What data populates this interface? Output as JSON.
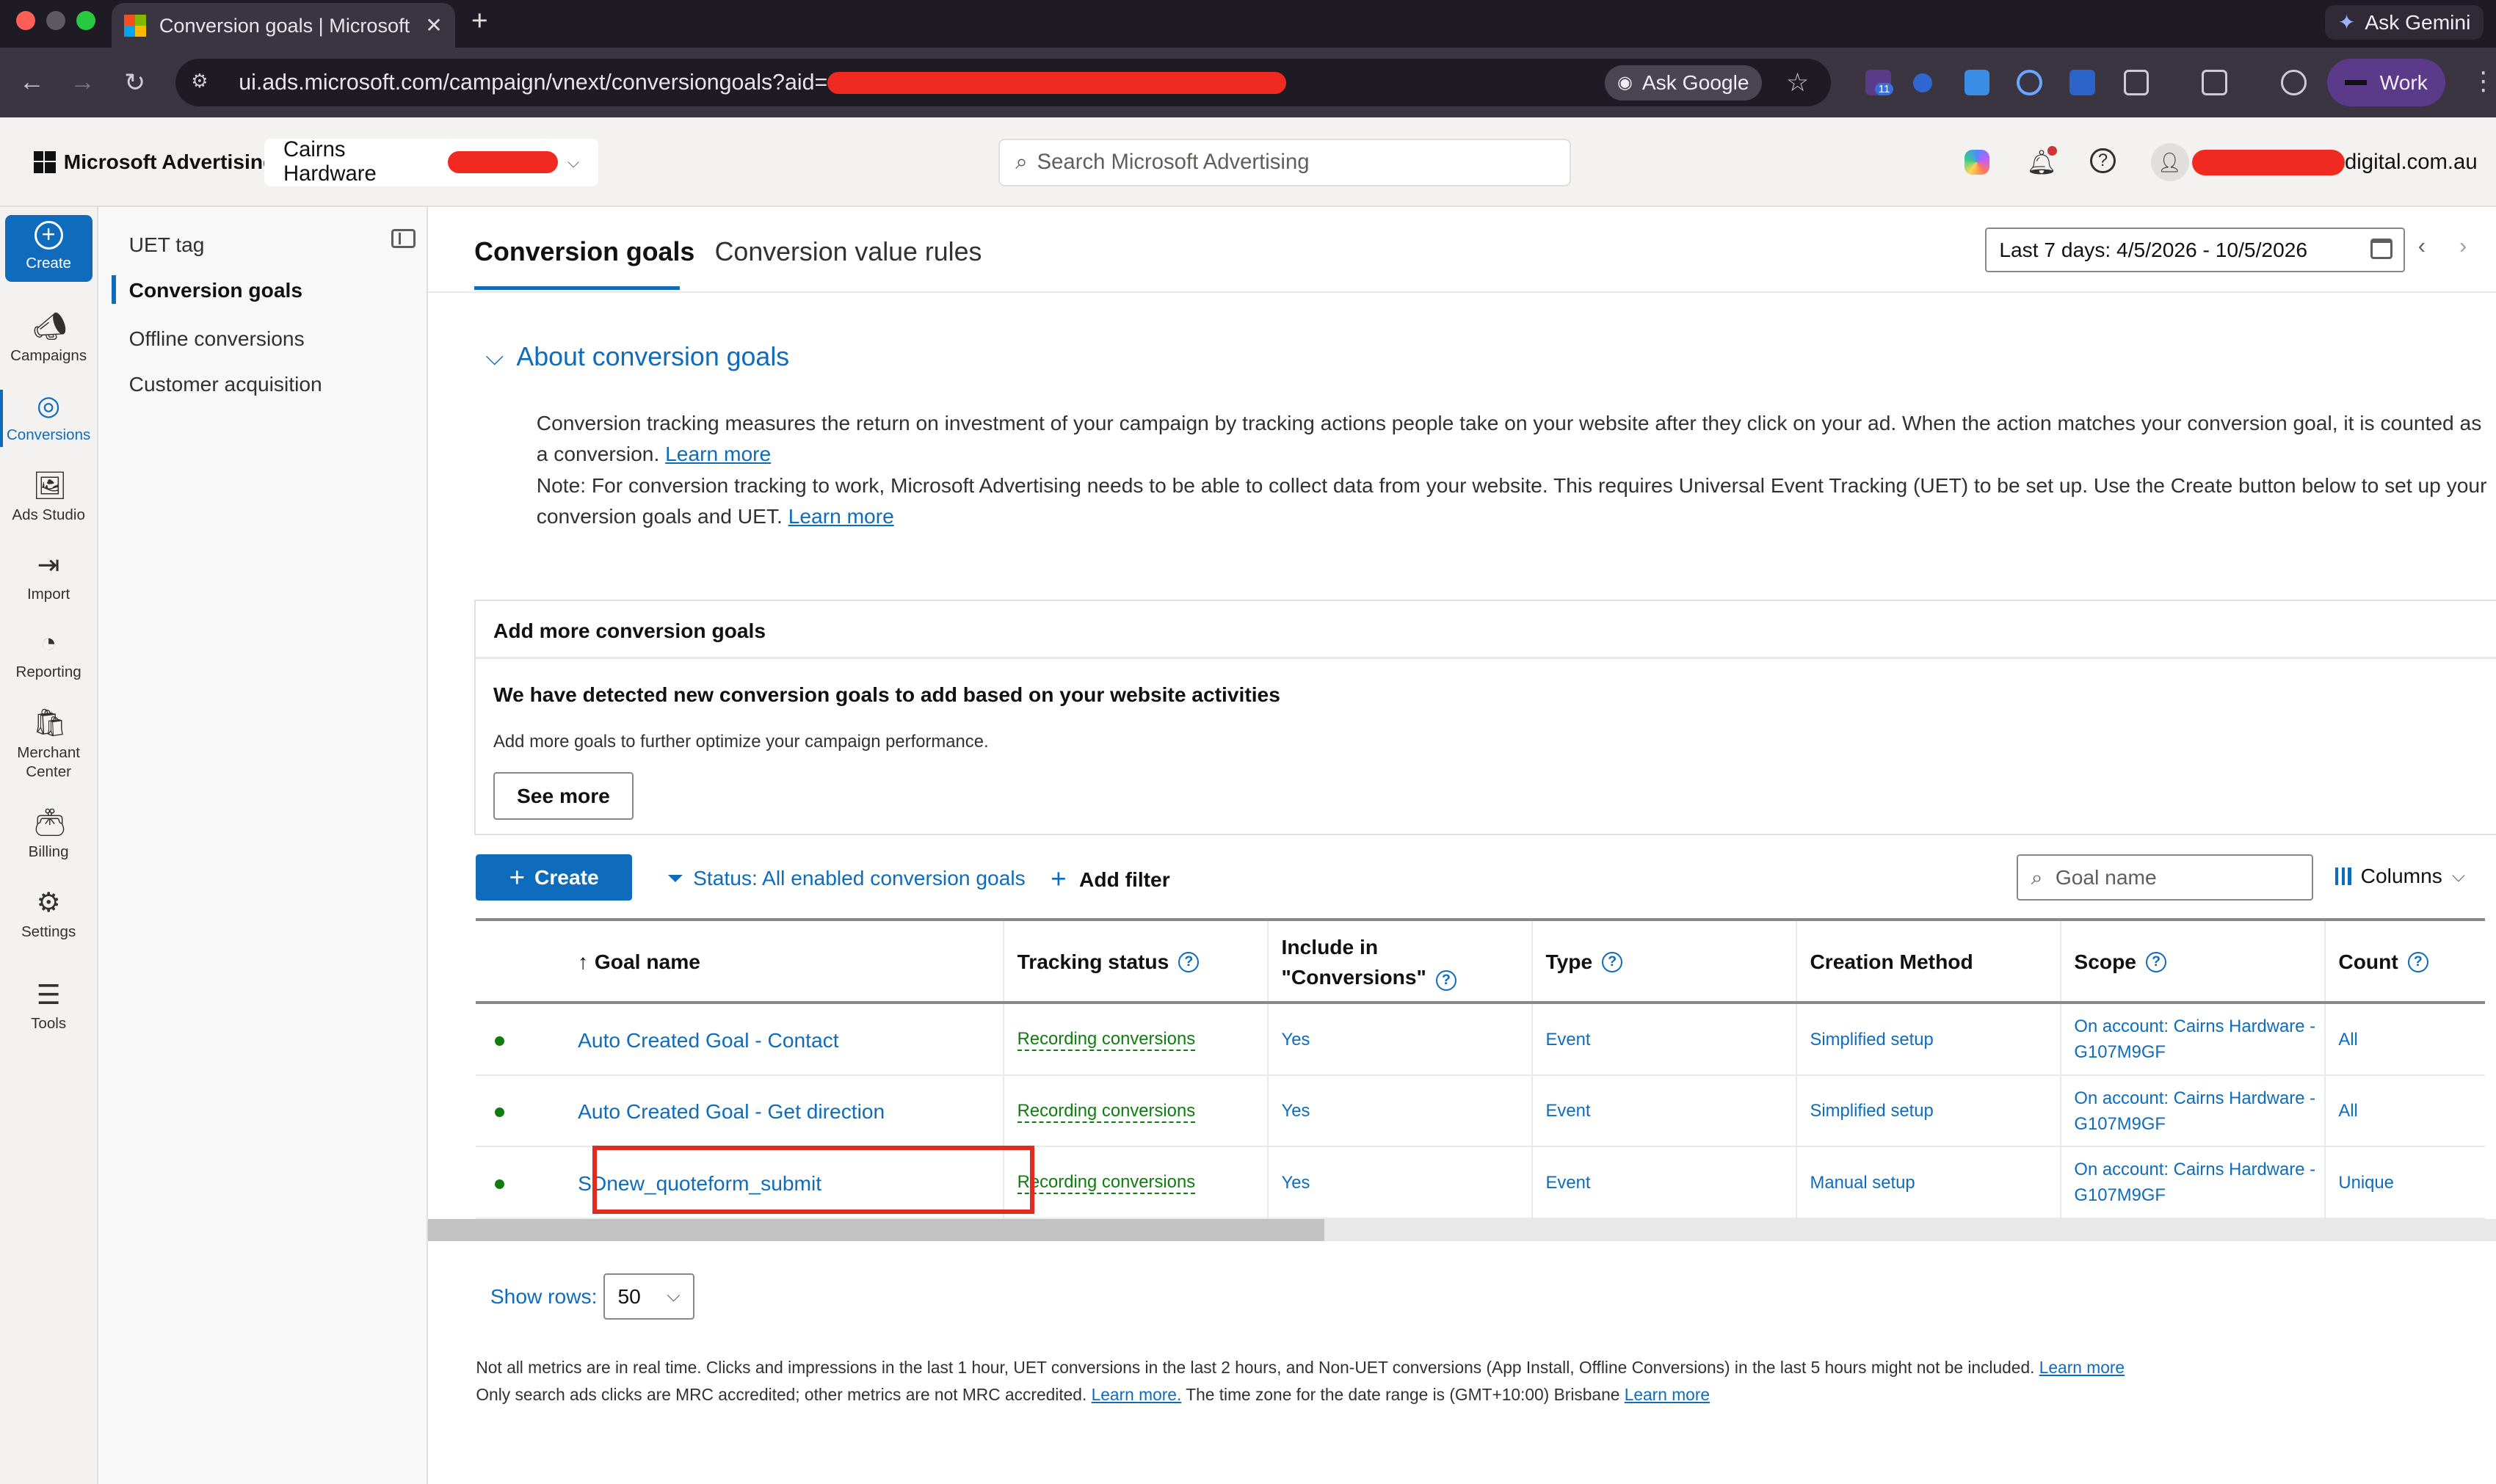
{
  "browser": {
    "tab_title": "Conversion goals | Microsoft",
    "tab_close": "✕",
    "new_tab": "+",
    "ask_gemini": "Ask Gemini",
    "url_prefix": "ui.ads.microsoft.com/campaign/vnext/conversiongoals?aid=",
    "ask_google": "Ask Google",
    "extension_badge": "11",
    "profile": "Work"
  },
  "header": {
    "brand": "Microsoft Advertising",
    "account": "Cairns Hardware",
    "search_placeholder": "Search Microsoft Advertising",
    "user_suffix": "digital.com.au"
  },
  "rail": {
    "items": [
      {
        "label": "Create"
      },
      {
        "label": "Campaigns"
      },
      {
        "label": "Conversions"
      },
      {
        "label": "Ads Studio"
      },
      {
        "label": "Import"
      },
      {
        "label": "Reporting"
      },
      {
        "label": "Merchant Center"
      },
      {
        "label": "Billing"
      },
      {
        "label": "Settings"
      },
      {
        "label": "Tools"
      }
    ]
  },
  "subnav": {
    "items": [
      {
        "label": "UET tag"
      },
      {
        "label": "Conversion goals"
      },
      {
        "label": "Offline conversions"
      },
      {
        "label": "Customer acquisition"
      }
    ]
  },
  "page": {
    "tabs": [
      {
        "label": "Conversion goals"
      },
      {
        "label": "Conversion value rules"
      }
    ],
    "date_range": "Last 7 days: 4/5/2026 - 10/5/2026"
  },
  "about": {
    "title": "About conversion goals",
    "para1": "Conversion tracking measures the return on investment of your campaign by tracking actions people take on your website after they click on your ad. When the action matches your conversion goal, it is counted as a conversion.",
    "para2": "Note: For conversion tracking to work, Microsoft Advertising needs to be able to collect data from your website. This requires Universal Event Tracking (UET) to be set up. Use the Create button below to set up your conversion goals and UET.",
    "learn_more": "Learn more"
  },
  "suggest_card": {
    "title": "Add more conversion goals",
    "heading": "We have detected new conversion goals to add based on your website activities",
    "description": "Add more goals to further optimize your campaign performance.",
    "button": "See more"
  },
  "toolbar": {
    "create": "Create",
    "status_filter": "Status: All enabled conversion goals",
    "add_filter": "Add filter",
    "goal_search_placeholder": "Goal name",
    "columns": "Columns"
  },
  "table": {
    "headers": {
      "goal_name": "Goal name",
      "tracking_status": "Tracking status",
      "include_line1": "Include in",
      "include_line2": "\"Conversions\"",
      "type": "Type",
      "creation_method": "Creation Method",
      "scope": "Scope",
      "count": "Count"
    },
    "rows": [
      {
        "name": "Auto Created Goal - Contact",
        "status": "Recording conversions",
        "include": "Yes",
        "type": "Event",
        "method": "Simplified setup",
        "scope1": "On account: Cairns Hardware -",
        "scope2": "G107M9GF",
        "count": "All"
      },
      {
        "name": "Auto Created Goal - Get direction",
        "status": "Recording conversions",
        "include": "Yes",
        "type": "Event",
        "method": "Simplified setup",
        "scope1": "On account: Cairns Hardware -",
        "scope2": "G107M9GF",
        "count": "All"
      },
      {
        "name": "SDnew_quoteform_submit",
        "status": "Recording conversions",
        "include": "Yes",
        "type": "Event",
        "method": "Manual setup",
        "scope1": "On account: Cairns Hardware -",
        "scope2": "G107M9GF",
        "count": "Unique"
      }
    ]
  },
  "pagination": {
    "label": "Show rows:",
    "value": "50"
  },
  "footer": {
    "line1": "Not all metrics are in real time. Clicks and impressions in the last 1 hour, UET conversions in the last 2 hours, and Non-UET conversions (App Install, Offline Conversions) in the last 5 hours might not be included.",
    "line2a": "Only search ads clicks are MRC accredited; other metrics are not MRC accredited.",
    "learn_more_dot": "Learn more.",
    "line2b": "The time zone for the date range is (GMT+10:00) Brisbane",
    "learn_more": "Learn more"
  },
  "colors": {
    "accent": "#0f6cbd",
    "success": "#107c10",
    "highlight": "#e02b20",
    "redaction": "#f12a21"
  }
}
